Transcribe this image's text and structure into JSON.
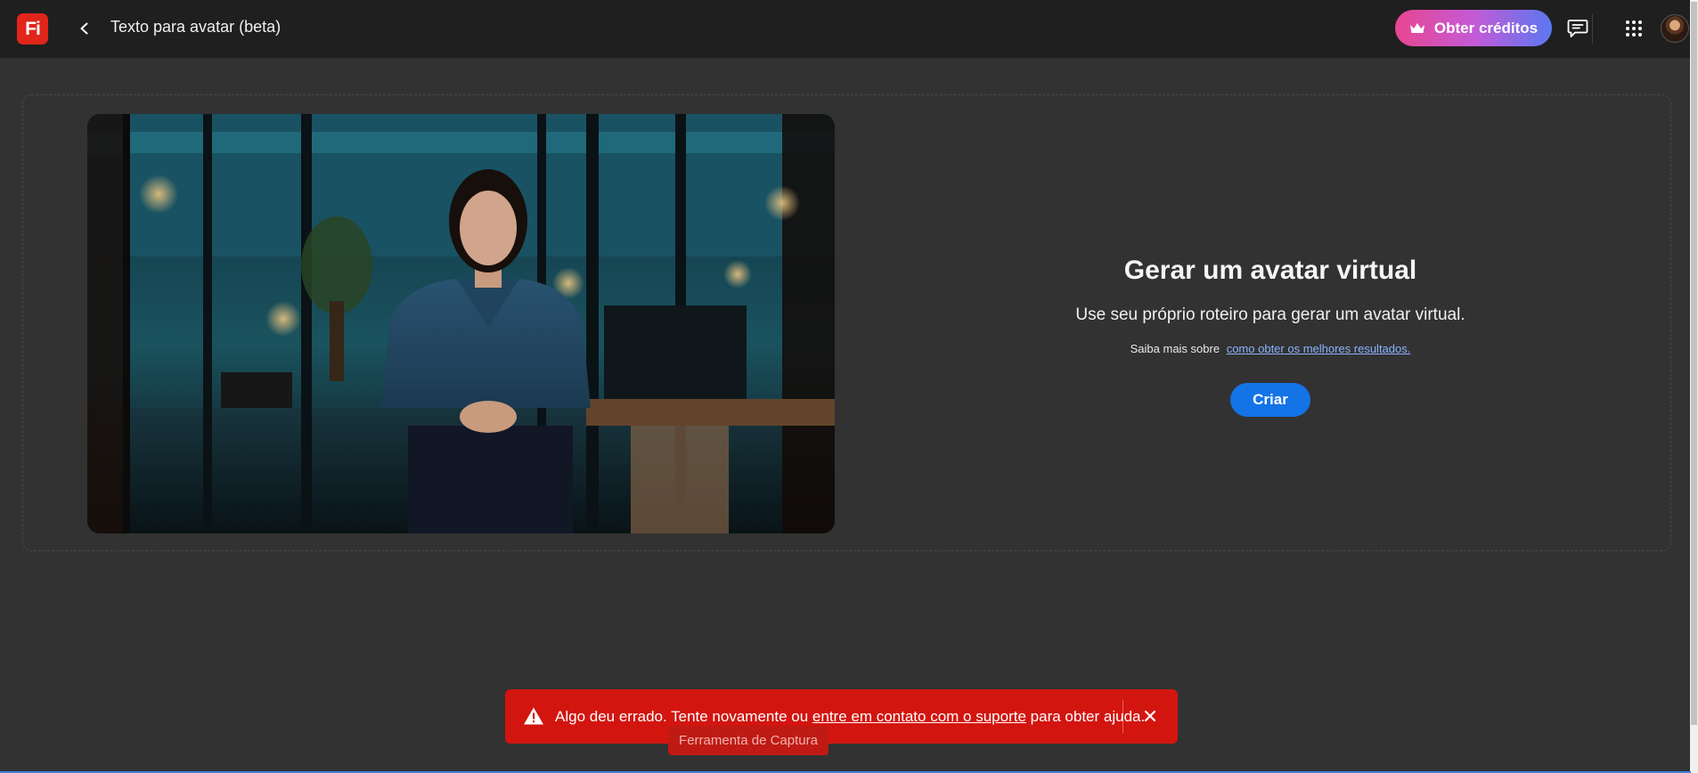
{
  "header": {
    "logo_text": "Fi",
    "title": "Texto para avatar (beta)",
    "credits_label": "Obter créditos",
    "icons": [
      "back-arrow-icon",
      "crown-icon",
      "chat-icon",
      "apps-grid-icon"
    ]
  },
  "hero": {
    "title": "Gerar um avatar virtual",
    "subtitle": "Use seu próprio roteiro para gerar um avatar virtual.",
    "learn_prefix": "Saiba mais sobre",
    "learn_link": "como obter os melhores resultados.",
    "create_label": "Criar"
  },
  "toast": {
    "text_before": "Algo deu errado. Tente novamente ou",
    "link": "entre em contato com o suporte",
    "text_after": "para obter ajuda.",
    "icon": "warning-icon"
  },
  "tooltip": {
    "text": "Ferramenta de Captura"
  },
  "colors": {
    "background": "#323232",
    "topbar": "#1f1f1f",
    "logo": "#e1251b",
    "primary_button": "#1473e6",
    "error_toast": "#d31510",
    "link": "#8ab4ff"
  }
}
